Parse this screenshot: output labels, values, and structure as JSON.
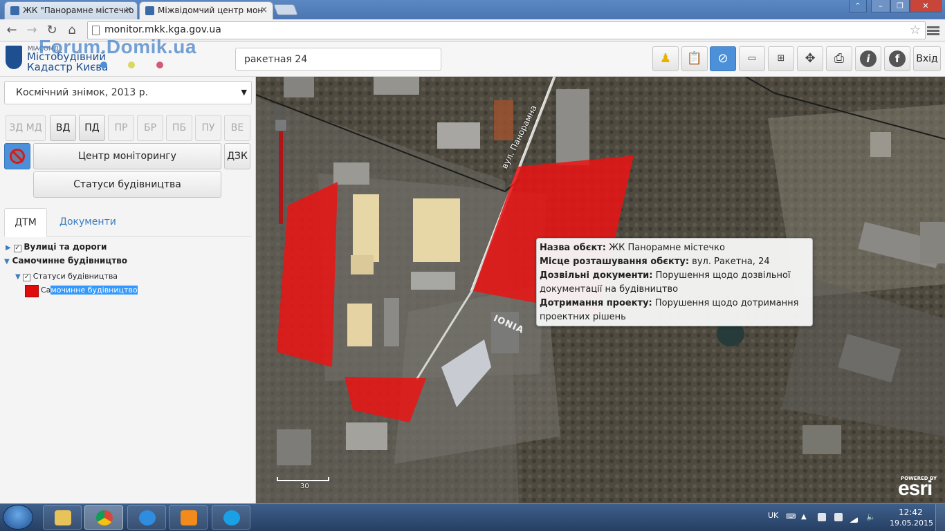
{
  "browser": {
    "tabs": [
      {
        "title": "ЖК \"Панорамне містечко"
      },
      {
        "title": "Міжвідомчий центр мон"
      }
    ],
    "close_glyph": "×",
    "url": "monitor.mkk.kga.gov.ua",
    "icons": [
      "back-icon",
      "forward-icon",
      "reload-icon",
      "home-icon",
      "star-icon",
      "menu-icon"
    ]
  },
  "header": {
    "logo_small": "МІАСОМД",
    "logo_line1": "Містобудівний",
    "logo_line2": "Кадастр Києва",
    "watermark": "Forum.Domik.ua",
    "search_value": "ракетная 24",
    "tools": [
      "pegman-icon",
      "clipboard-icon",
      "compass-icon",
      "ruler-icon",
      "measure-area-icon",
      "move-icon",
      "printer-icon",
      "info-icon",
      "facebook-icon"
    ],
    "exit_label": "Вхід",
    "dot_colors": [
      "#4a90d9",
      "#d7d960",
      "#d35a78"
    ]
  },
  "sidebar": {
    "layer_select": "Космічний знімок, 2013 р.",
    "caret": "▼",
    "layer_buttons": [
      {
        "label": "ЗД МД",
        "enabled": false
      },
      {
        "label": "ВД",
        "enabled": true
      },
      {
        "label": "ПД",
        "enabled": true
      },
      {
        "label": "ПР",
        "enabled": false
      },
      {
        "label": "БР",
        "enabled": false
      },
      {
        "label": "ПБ",
        "enabled": false
      },
      {
        "label": "ПУ",
        "enabled": false
      },
      {
        "label": "ВЕ",
        "enabled": false
      }
    ],
    "monitoring_center": "Центр моніторингу",
    "dzk": "ДЗК",
    "construction_status": "Статуси будівництва",
    "tabs": {
      "dtm": "ДТМ",
      "documents": "Документи"
    },
    "tree": {
      "streets": "Вулиці та дороги",
      "unauthorized": "Самочинне будівництво",
      "statuses": "Статуси будівництва",
      "legend_prefix": "Са",
      "legend_selected": "мочинне будівництво",
      "check": "✓"
    }
  },
  "map": {
    "street_label": "вул. Панорамна",
    "building_sign": "IONIA",
    "scale_label": "30",
    "esri_small": "POWERED BY",
    "esri": "esri",
    "popup": {
      "name_label": "Назва обєкт:",
      "name_value": " ЖК Панорамне містечко",
      "location_label": "Місце розташування обєкту:",
      "location_value": " вул. Ракетна, 24",
      "permits_label": "Дозвільні документи:",
      "permits_value": " Порушення щодо дозвільної документації на будівництво",
      "compliance_label": "Дотримання проекту:",
      "compliance_value": " Порушення щодо дотримання проектних рішень"
    }
  },
  "taskbar": {
    "apps": [
      "explorer-icon",
      "chrome-icon",
      "ie-icon",
      "media-player-icon",
      "skype-icon"
    ],
    "language": "UK",
    "time": "12:42",
    "date": "19.05.2015"
  }
}
